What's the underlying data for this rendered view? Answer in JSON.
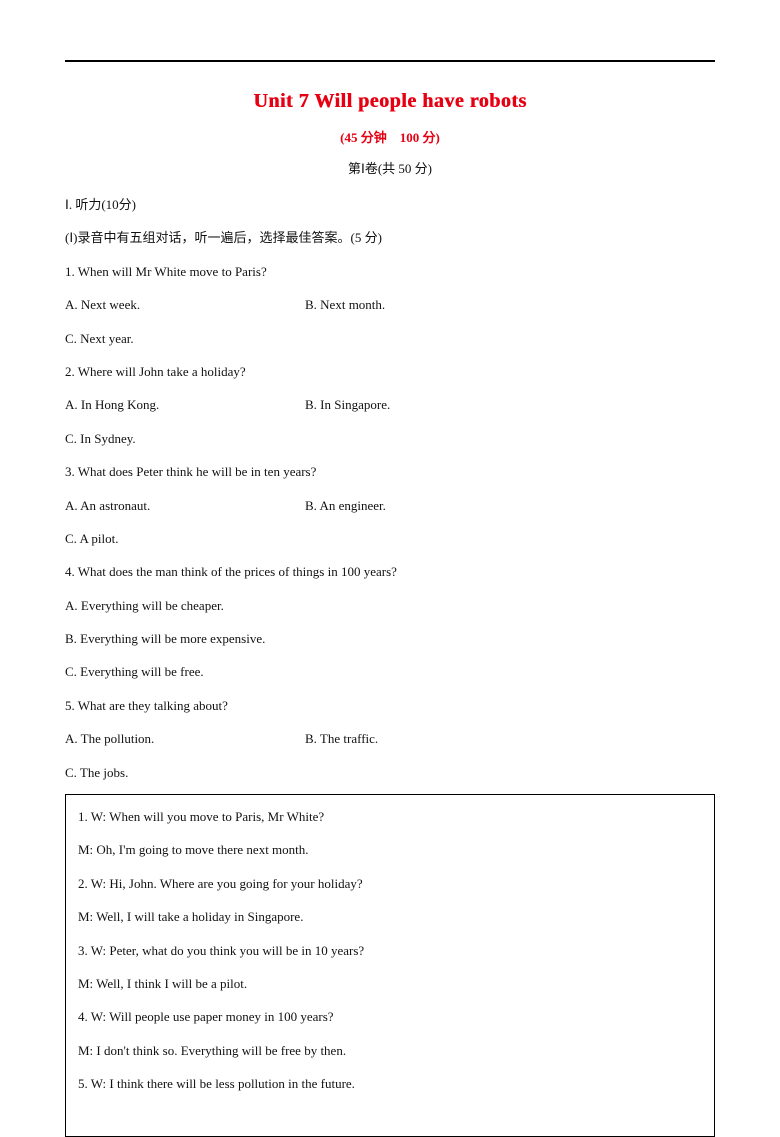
{
  "header": {
    "title": "Unit 7 Will people have robots",
    "subtitle": "(45 分钟　100 分)",
    "paper_section": "第Ⅰ卷(共 50 分)"
  },
  "listening": {
    "heading": "Ⅰ. 听力(10分)",
    "part1_instruction": "(Ⅰ)录音中有五组对话，听一遍后，选择最佳答案。(5 分)",
    "q1": {
      "text": "1. When will Mr White move to Paris?",
      "a": "A. Next week.",
      "b": "B. Next month.",
      "c": "C. Next year."
    },
    "q2": {
      "text": "2. Where will John take a holiday?",
      "a": "A. In Hong Kong.",
      "b": "B. In Singapore.",
      "c": "C. In Sydney."
    },
    "q3": {
      "text": "3. What does Peter think he will be in ten years?",
      "a": "A. An astronaut.",
      "b": "B. An engineer.",
      "c": "C. A pilot."
    },
    "q4": {
      "text": "4. What does the man think of the prices of things in 100 years?",
      "a": "A. Everything will be cheaper.",
      "b": "B. Everything will be more expensive.",
      "c": "C. Everything will be free."
    },
    "q5": {
      "text": "5. What are they talking about?",
      "a": "A. The pollution.",
      "b": "B. The traffic.",
      "c": "C. The jobs."
    }
  },
  "transcript": {
    "l1": "1. W: When will you move to Paris, Mr White?",
    "l2": "M: Oh, I'm going to move there next month.",
    "l3": "2. W: Hi, John. Where are you going for your holiday?",
    "l4": "M: Well, I will take a holiday in Singapore.",
    "l5": "3. W: Peter, what do you think you will be in 10 years?",
    "l6": "M: Well, I think I will be a pilot.",
    "l7": "4. W: Will people use paper money in 100 years?",
    "l8": "M: I don't think so. Everything will be free by then.",
    "l9": "5. W: I think there will be less pollution in the future."
  }
}
